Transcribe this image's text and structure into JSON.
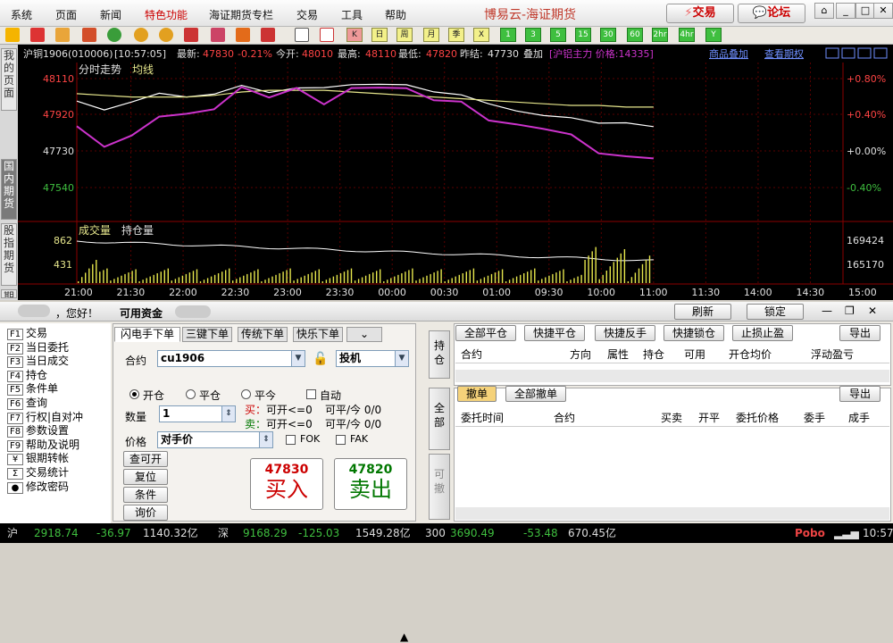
{
  "menu": [
    "系统",
    "页面",
    "新闻",
    "特色功能",
    "海证期货专栏",
    "交易",
    "工具",
    "帮助"
  ],
  "app_title": "博易云-海证期货",
  "top_buttons": {
    "trade": "交易",
    "forum": "论坛"
  },
  "toolbar_keys": [
    "K",
    "日",
    "周",
    "月",
    "季",
    "X",
    "1",
    "3",
    "5",
    "15",
    "30",
    "60",
    "2hr",
    "4hr",
    "Y"
  ],
  "side_tabs": [
    "我的页面",
    "国内期货",
    "股指期货",
    "期权报"
  ],
  "quote": {
    "name": "沪铜1906(010006)",
    "time": "[10:57:05]",
    "last_label": "最新:",
    "last": "47830",
    "change": "-0.21%",
    "open_label": "今开:",
    "open": "48010",
    "high_label": "最高:",
    "high": "48110",
    "low_label": "最低:",
    "low": "47820",
    "prev_label": "昨结:",
    "prev": "47730",
    "overlay_label": "叠加",
    "overlay": "[沪铝主力 价格:14335]",
    "link1": "商品叠加",
    "link2": "查看期权"
  },
  "chart_data": {
    "type": "line",
    "title": "分时走势",
    "subtitle": "均线",
    "price_ticks": [
      "48110",
      "47920",
      "47730",
      "47540"
    ],
    "pct_ticks": [
      "+0.80%",
      "+0.40%",
      "+0.00%",
      "-0.40%"
    ],
    "ylim": [
      47460,
      48110
    ],
    "volume_title": "成交量",
    "oi_title": "持仓量",
    "volume_ticks": [
      "862",
      "431"
    ],
    "oi_ticks": [
      "169424",
      "165170"
    ],
    "x_ticks": [
      "21:00",
      "21:30",
      "22:00",
      "22:30",
      "23:00",
      "23:30",
      "00:00",
      "00:30",
      "01:00",
      "09:30",
      "10:00",
      "11:00",
      "11:30",
      "14:00",
      "14:30",
      "15:00"
    ],
    "series": [
      {
        "name": "价格",
        "color": "#ffffff",
        "values": [
          47960,
          47920,
          47980,
          48010,
          48000,
          48030,
          48060,
          48030,
          48070,
          48050,
          48080,
          48060,
          48070,
          48040,
          48000,
          47960,
          47930,
          47880,
          47880,
          47860,
          47840,
          47830
        ]
      },
      {
        "name": "均线",
        "color": "#e6e68c",
        "values": [
          48020,
          48010,
          48000,
          48000,
          48000,
          48010,
          48030,
          48040,
          48040,
          48040,
          48030,
          48020,
          48010,
          48000,
          47990,
          47980,
          47970,
          47960,
          47950,
          47950,
          47940,
          47940
        ]
      },
      {
        "name": "沪铝主力",
        "color": "#cc33cc",
        "values": [
          47810,
          47700,
          47780,
          47870,
          47900,
          47940,
          48050,
          48000,
          48070,
          47950,
          48060,
          48040,
          48050,
          47990,
          47960,
          47860,
          47850,
          47800,
          47780,
          47680,
          47640,
          47640
        ]
      }
    ]
  },
  "lower": {
    "greeting": "，您好！",
    "funds": "可用资金",
    "refresh": "刷新",
    "lock": "锁定",
    "fkeys": [
      [
        "F1",
        "交易"
      ],
      [
        "F2",
        "当日委托"
      ],
      [
        "F3",
        "当日成交"
      ],
      [
        "F4",
        "持仓"
      ],
      [
        "F5",
        "条件单"
      ],
      [
        "F6",
        "查询"
      ],
      [
        "F7",
        "行权|自对冲"
      ],
      [
        "F8",
        "参数设置"
      ],
      [
        "F9",
        "帮助及说明"
      ],
      [
        "¥",
        "银期转帐"
      ],
      [
        "Σ",
        "交易统计"
      ],
      [
        "●",
        "修改密码"
      ]
    ],
    "tabs": [
      "闪电手下单",
      "三键下单",
      "传统下单",
      "快乐下单"
    ],
    "contract_label": "合约",
    "contract": "cu1906",
    "hedge": "投机",
    "open": "开仓",
    "close": "平仓",
    "close_today": "平今",
    "auto": "自动",
    "qty_label": "数量",
    "qty": "1",
    "buy_can": "买：",
    "buy_can_open": "可开<=0",
    "buy_can_close": "可平/今 0/0",
    "sell_can": "卖：",
    "sell_can_open": "可开<=0",
    "sell_can_close": "可平/今 0/0",
    "price_label": "价格",
    "price": "对手价",
    "fok": "FOK",
    "fak": "FAK",
    "query_btn": "查可开",
    "reset_btn": "复位",
    "cond_btn": "条件",
    "ask_btn": "询价",
    "buy_price": "47830",
    "buy": "买入",
    "sell_price": "47820",
    "sell": "卖出",
    "vtabs": [
      "持仓",
      "全部",
      "可撤"
    ],
    "pos_buttons": [
      "全部平仓",
      "快捷平仓",
      "快捷反手",
      "快捷锁仓",
      "止损止盈"
    ],
    "export": "导出",
    "pos_cols": [
      "合约",
      "方向",
      "属性",
      "持仓",
      "可用",
      "开仓均价",
      "浮动盈亏"
    ],
    "order_buttons": [
      "撤单",
      "全部撤单"
    ],
    "order_cols": [
      "委托时间",
      "合约",
      "买卖",
      "开平",
      "委托价格",
      "委手",
      "成手"
    ]
  },
  "status": {
    "sh": "沪",
    "sh_idx": "2918.74",
    "sh_chg": "-36.97",
    "sh_amt": "1140.32亿",
    "sz": "深",
    "sz_idx": "9168.29",
    "sz_chg": "-125.03",
    "sz_amt": "1549.28亿",
    "t3": "300",
    "t3_idx": "3690.49",
    "t3_chg": "-53.48",
    "t3_amt": "670.45亿",
    "brand": "Pobo",
    "time": "10:57"
  }
}
